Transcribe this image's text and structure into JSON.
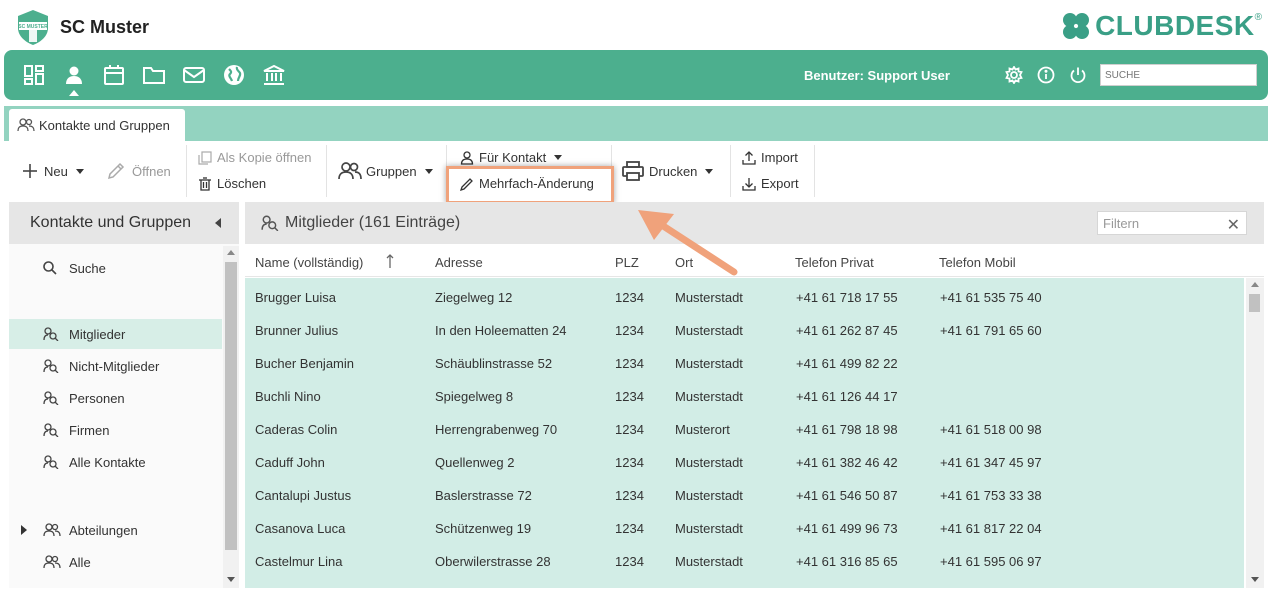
{
  "app": {
    "club_name": "SC Muster",
    "badge_text": "SC MUSTER",
    "logo_text": "CLUBDESK",
    "logo_reg": "®",
    "brand_color": "#4caf8e"
  },
  "navbar": {
    "icons": [
      "dashboard-icon",
      "person-icon",
      "calendar-icon",
      "folder-icon",
      "mail-icon",
      "globe-icon",
      "bank-icon"
    ],
    "user_label": "Benutzer: Support User",
    "search_placeholder": "SUCHE",
    "right_icons": [
      "settings-icon",
      "info-icon",
      "power-icon"
    ]
  },
  "tabs": [
    {
      "label": "Kontakte und Gruppen",
      "icon": "people-icon"
    }
  ],
  "toolbar": {
    "new_label": "Neu",
    "open_label": "Öffnen",
    "copy_label": "Als Kopie öffnen",
    "delete_label": "Löschen",
    "groups_label": "Gruppen",
    "for_contact_label": "Für Kontakt",
    "bulk_edit_label": "Mehrfach-Änderung",
    "print_label": "Drucken",
    "import_label": "Import",
    "export_label": "Export"
  },
  "sidebar": {
    "title": "Kontakte und Gruppen",
    "search_label": "Suche",
    "items": [
      {
        "label": "Mitglieder",
        "active": true
      },
      {
        "label": "Nicht-Mitglieder"
      },
      {
        "label": "Personen"
      },
      {
        "label": "Firmen"
      },
      {
        "label": "Alle Kontakte"
      }
    ],
    "groups": [
      {
        "label": "Abteilungen",
        "expandable": true
      },
      {
        "label": "Alle"
      }
    ]
  },
  "main": {
    "title": "Mitglieder (161 Einträge)",
    "filter_placeholder": "Filtern",
    "columns": [
      "Name (vollständig)",
      "Adresse",
      "PLZ",
      "Ort",
      "Telefon Privat",
      "Telefon Mobil"
    ],
    "rows": [
      [
        "Brugger Luisa",
        "Ziegelweg 12",
        "1234",
        "Musterstadt",
        "+41 61 718 17 55",
        "+41 61 535 75 40"
      ],
      [
        "Brunner Julius",
        "In den Holeematten 24",
        "1234",
        "Musterstadt",
        "+41 61 262 87 45",
        "+41 61 791 65 60"
      ],
      [
        "Bucher Benjamin",
        "Schäublinstrasse 52",
        "1234",
        "Musterstadt",
        "+41 61 499 82 22",
        ""
      ],
      [
        "Buchli Nino",
        "Spiegelweg 8",
        "1234",
        "Musterstadt",
        "+41 61 126 44 17",
        ""
      ],
      [
        "Caderas Colin",
        "Herrengrabenweg 70",
        "1234",
        "Musterort",
        "+41 61 798 18 98",
        "+41 61 518 00 98"
      ],
      [
        "Caduff John",
        "Quellenweg 2",
        "1234",
        "Musterstadt",
        "+41 61 382 46 42",
        "+41 61 347 45 97"
      ],
      [
        "Cantalupi Justus",
        "Baslerstrasse 72",
        "1234",
        "Musterstadt",
        "+41 61 546 50 87",
        "+41 61 753 33 38"
      ],
      [
        "Casanova Luca",
        "Schützenweg 19",
        "1234",
        "Musterstadt",
        "+41 61 499 96 73",
        "+41 61 817 22 04"
      ],
      [
        "Castelmur Lina",
        "Oberwilerstrasse 28",
        "1234",
        "Musterstadt",
        "+41 61 316 85 65",
        "+41 61 595 06 97"
      ]
    ]
  },
  "colors": {
    "navbar": "#4caf8e",
    "tabstrip": "#93d3c0",
    "row_bg": "#d2ede6",
    "highlight": "#f0a27b"
  }
}
